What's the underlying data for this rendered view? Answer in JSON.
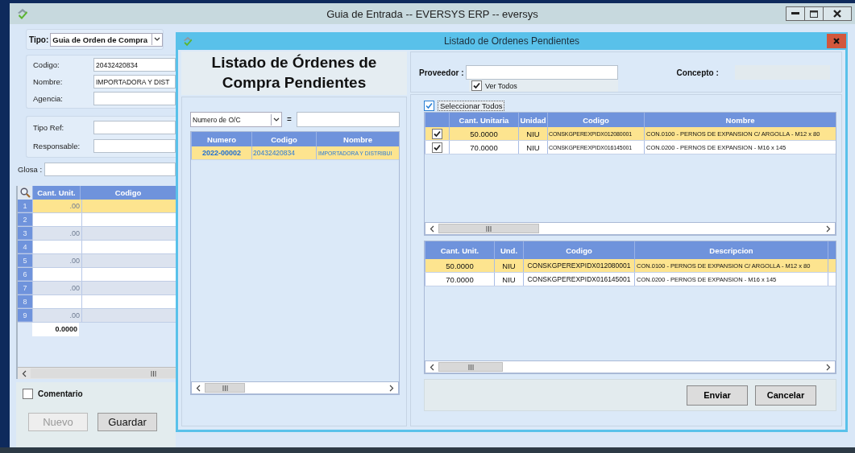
{
  "main_window": {
    "title": "Guia de Entrada -- EVERSYS ERP -- eversys",
    "tipo": {
      "label": "Tipo:",
      "value": "Guia de Orden de Compra"
    },
    "fields": [
      {
        "label": "Codigo:",
        "value": "20432420834"
      },
      {
        "label": "Nombre:",
        "value": "IMPORTADORA Y DIST"
      },
      {
        "label": "Agencia:"
      }
    ],
    "ref_fields": [
      {
        "label": "Tipo Ref:"
      },
      {
        "label": "Responsable:"
      }
    ],
    "glosa": {
      "label": "Glosa :"
    },
    "grid": {
      "columns": [
        "Cant. Unit.",
        "Codigo"
      ],
      "rows": [
        {
          "number": "1",
          "cant": ".00",
          "selected": true
        },
        {
          "number": "2",
          "selected": false
        },
        {
          "number": "3",
          "cant": ".00",
          "selected": false
        },
        {
          "number": "4",
          "selected": false
        },
        {
          "number": "5",
          "cant": ".00",
          "selected": false
        },
        {
          "number": "6",
          "selected": false
        },
        {
          "number": "7",
          "cant": ".00",
          "selected": false
        },
        {
          "number": "8",
          "selected": false
        },
        {
          "number": "9",
          "cant": ".00",
          "selected": false
        }
      ],
      "total": "0.0000"
    },
    "comentario": {
      "label": "Comentario",
      "checked": false
    },
    "buttons": [
      {
        "label": "Nuevo",
        "disabled": true
      },
      {
        "label": "Guardar",
        "disabled": false
      }
    ]
  },
  "dialog": {
    "title": "Listado de Ordenes Pendientes",
    "heading": "Listado de Órdenes de Compra Pendientes",
    "filter": {
      "field": "Numero de O/C",
      "operator": "="
    },
    "orders": {
      "columns": [
        "Numero",
        "Codigo",
        "Nombre"
      ],
      "rows": [
        {
          "numero": "2022-00002",
          "codigo": "20432420834",
          "nombre": "IMPORTADORA Y DISTRIBUI",
          "selected": true
        }
      ]
    },
    "proveedor": {
      "label": "Proveedor :"
    },
    "ver_todos": {
      "label": "Ver Todos",
      "checked": true
    },
    "concepto": {
      "label": "Concepto :"
    },
    "seleccionar_todos": {
      "label": "Seleccionar Todos",
      "checked": true
    },
    "items": {
      "columns": [
        "Cant. Unitaria",
        "Unidad",
        "Codigo",
        "Nombre"
      ],
      "rows": [
        {
          "checked": true,
          "selected": true,
          "cant": "50.0000",
          "unidad": "NIU",
          "codigo": "CONSKGPEREXPIDX012080001",
          "nombre": "CON.0100 - PERNOS DE EXPANSION C/ ARGOLLA - M12 x 80"
        },
        {
          "checked": true,
          "selected": false,
          "cant": "70.0000",
          "unidad": "NIU",
          "codigo": "CONSKGPEREXPIDX016145001",
          "nombre": "CON.0200 - PERNOS DE EXPANSION - M16 x 145"
        }
      ]
    },
    "detail": {
      "columns": [
        "Cant. Unit.",
        "Und.",
        "Codigo",
        "Descripcion"
      ],
      "rows": [
        {
          "selected": true,
          "cant": "50.0000",
          "und": "NIU",
          "codigo": "CONSKGPEREXPIDX012080001",
          "descripcion": "CON.0100 - PERNOS DE EXPANSION C/ ARGOLLA - M12 x 80"
        },
        {
          "selected": false,
          "cant": "70.0000",
          "und": "NIU",
          "codigo": "CONSKGPEREXPIDX016145001",
          "descripcion": "CON.0200 - PERNOS DE EXPANSION - M16 x 145"
        }
      ]
    },
    "buttons": [
      {
        "label": "Enviar"
      },
      {
        "label": "Cancelar"
      }
    ]
  }
}
